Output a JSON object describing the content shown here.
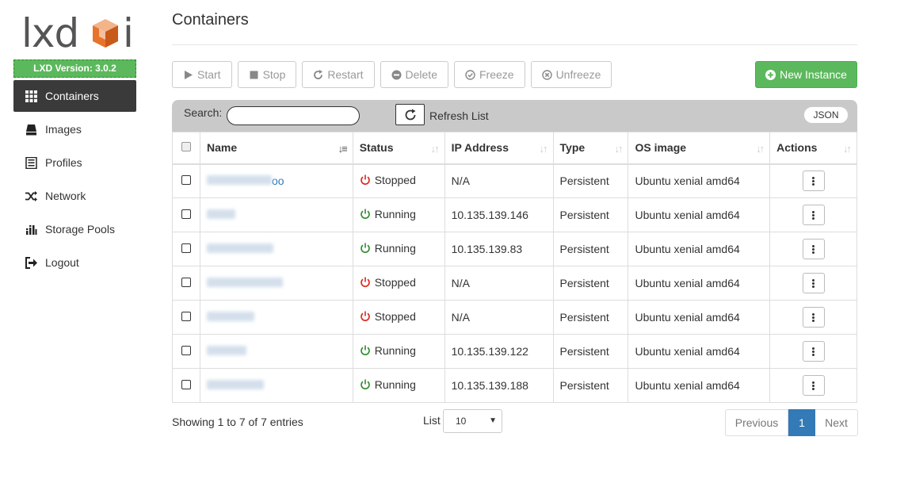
{
  "brand": {
    "logo_left": "lxd",
    "logo_right": "i",
    "version": "LXD Version: 3.0.2"
  },
  "sidebar": {
    "items": [
      {
        "label": "Containers",
        "icon": "grid-icon",
        "active": true
      },
      {
        "label": "Images",
        "icon": "disk-icon"
      },
      {
        "label": "Profiles",
        "icon": "list-icon"
      },
      {
        "label": "Network",
        "icon": "shuffle-icon"
      },
      {
        "label": "Storage Pools",
        "icon": "bars-icon"
      },
      {
        "label": "Logout",
        "icon": "logout-icon"
      }
    ]
  },
  "page": {
    "title": "Containers"
  },
  "toolbar": {
    "start": "Start",
    "stop": "Stop",
    "restart": "Restart",
    "delete": "Delete",
    "freeze": "Freeze",
    "unfreeze": "Unfreeze",
    "new_instance": "New Instance"
  },
  "table_controls": {
    "search_label": "Search:",
    "search_value": "",
    "refresh": "Refresh List",
    "json": "JSON"
  },
  "table": {
    "headers": [
      "Name",
      "Status",
      "IP Address",
      "Type",
      "OS image",
      "Actions"
    ],
    "rows": [
      {
        "name": "oo",
        "status": "Stopped",
        "ip": "N/A",
        "type": "Persistent",
        "os": "Ubuntu xenial amd64"
      },
      {
        "name": "",
        "status": "Running",
        "ip": "10.135.139.146",
        "type": "Persistent",
        "os": "Ubuntu xenial amd64"
      },
      {
        "name": "",
        "status": "Running",
        "ip": "10.135.139.83",
        "type": "Persistent",
        "os": "Ubuntu xenial amd64"
      },
      {
        "name": "",
        "status": "Stopped",
        "ip": "N/A",
        "type": "Persistent",
        "os": "Ubuntu xenial amd64"
      },
      {
        "name": "",
        "status": "Stopped",
        "ip": "N/A",
        "type": "Persistent",
        "os": "Ubuntu xenial amd64"
      },
      {
        "name": "",
        "status": "Running",
        "ip": "10.135.139.122",
        "type": "Persistent",
        "os": "Ubuntu xenial amd64"
      },
      {
        "name": "",
        "status": "Running",
        "ip": "10.135.139.188",
        "type": "Persistent",
        "os": "Ubuntu xenial amd64"
      }
    ]
  },
  "footer": {
    "info": "Showing 1 to 7 of 7 entries",
    "list_label": "List",
    "page_size": "10",
    "prev": "Previous",
    "page": "1",
    "next": "Next"
  },
  "colors": {
    "running": "#2e8b2e",
    "stopped": "#d9261c",
    "accent": "#5cb85c",
    "link": "#337ab7"
  }
}
